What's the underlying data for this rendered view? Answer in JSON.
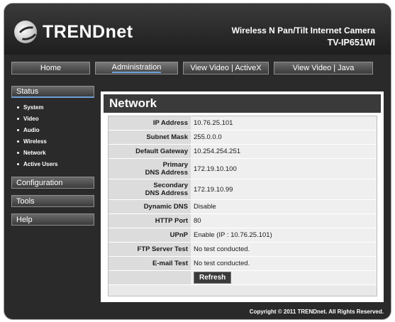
{
  "brand": {
    "name": "TRENDnet",
    "product_title": "Wireless N Pan/Tilt Internet Camera",
    "model": "TV-IP651WI"
  },
  "nav": {
    "items": [
      {
        "label": "Home"
      },
      {
        "label": "Administration"
      },
      {
        "label": "View Video | ActiveX"
      },
      {
        "label": "View Video | Java"
      }
    ]
  },
  "sidebar": {
    "status": "Status",
    "submenu": [
      "System",
      "Video",
      "Audio",
      "Wireless",
      "Network",
      "Active Users"
    ],
    "configuration": "Configuration",
    "tools": "Tools",
    "help": "Help"
  },
  "page": {
    "title": "Network"
  },
  "network": {
    "rows": [
      {
        "label": "IP Address",
        "value": "10.76.25.101"
      },
      {
        "label": "Subnet Mask",
        "value": "255.0.0.0"
      },
      {
        "label": "Default Gateway",
        "value": "10.254.254.251"
      },
      {
        "label_line1": "Primary",
        "label_line2": "DNS Address",
        "value": "172.19.10.100"
      },
      {
        "label_line1": "Secondary",
        "label_line2": "DNS Address",
        "value": "172.19.10.99"
      },
      {
        "label": "Dynamic DNS",
        "value": "Disable"
      },
      {
        "label": "HTTP Port",
        "value": "80"
      },
      {
        "label": "UPnP",
        "value": "Enable (IP : 10.76.25.101)"
      },
      {
        "label": "FTP Server Test",
        "value": "No test conducted."
      },
      {
        "label": "E-mail Test",
        "value": "No test conducted."
      }
    ],
    "refresh_label": "Refresh"
  },
  "footer": {
    "copyright": "Copyright © 2011 TRENDnet. All Rights Reserved."
  },
  "colors": {
    "accent": "#6fa0d8",
    "panel": "#2a2a2a"
  }
}
